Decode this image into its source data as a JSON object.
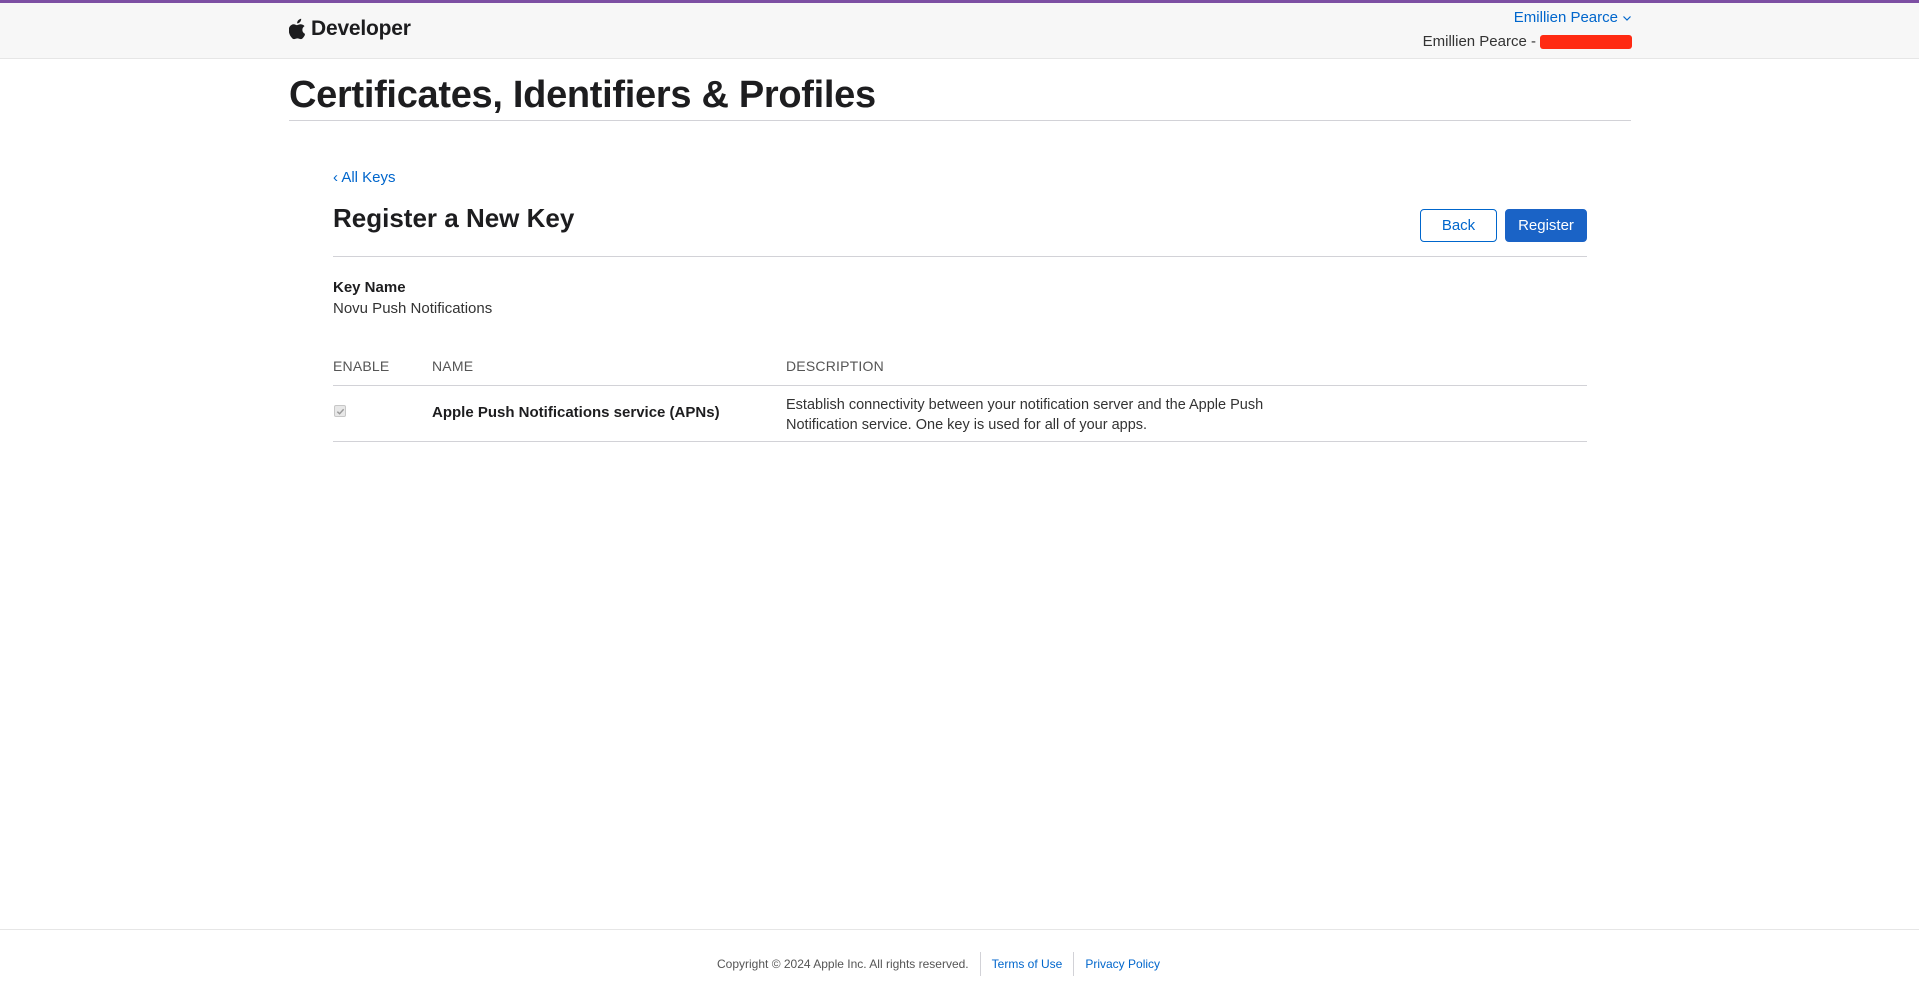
{
  "nav": {
    "brand": "Developer",
    "account_name": "Emillien Pearce",
    "team_prefix": "Emillien Pearce -"
  },
  "page": {
    "title": "Certificates, Identifiers & Profiles"
  },
  "section": {
    "back_link": "‹ All Keys",
    "title": "Register a New Key",
    "back_button": "Back",
    "register_button": "Register"
  },
  "key": {
    "label": "Key Name",
    "value": "Novu Push Notifications"
  },
  "table": {
    "headers": [
      "ENABLE",
      "NAME",
      "DESCRIPTION"
    ],
    "rows": [
      {
        "enabled": true,
        "name": "Apple Push Notifications service (APNs)",
        "description": "Establish connectivity between your notification server and the Apple Push Notification service. One key is used for all of your apps."
      }
    ]
  },
  "footer": {
    "copyright": "Copyright © 2024 Apple Inc. All rights reserved.",
    "terms": "Terms of Use",
    "privacy": "Privacy Policy"
  },
  "colors": {
    "accent": "#0066cc",
    "primary_button": "#1a63c6",
    "top_line": "#7d4fa3",
    "redaction": "#ff2a12"
  }
}
